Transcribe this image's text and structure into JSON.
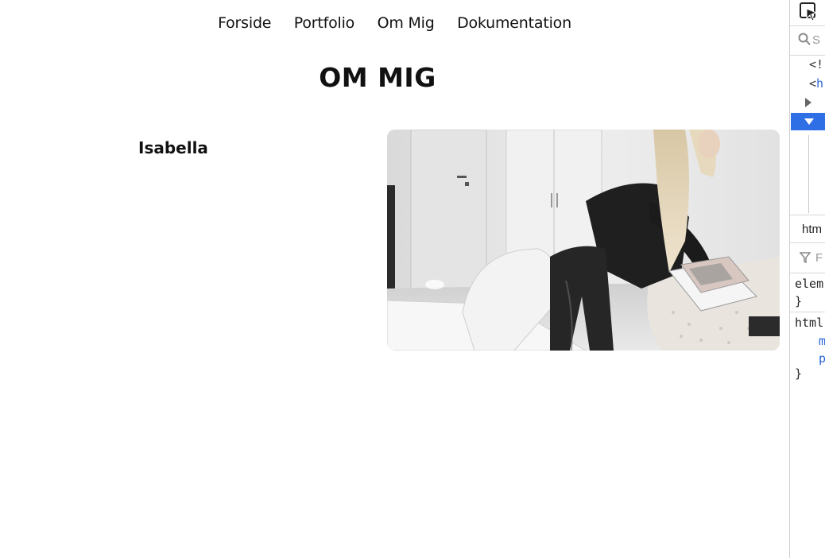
{
  "nav": {
    "items": [
      {
        "label": "Forside"
      },
      {
        "label": "Portfolio"
      },
      {
        "label": "Om Mig"
      },
      {
        "label": "Dokumentation"
      }
    ]
  },
  "page": {
    "title": "OM MIG",
    "name": "Isabella"
  },
  "devtools": {
    "search_text": "S",
    "tree": {
      "line1_text": "<!",
      "line2_bracket": "<",
      "line2_tag": "h",
      "line3_text": "·",
      "line4_text": "·"
    },
    "breadcrumb": "htm",
    "filter_text": "F",
    "rules": {
      "element_selector": "elem",
      "close1": "}",
      "html_selector": "html",
      "prop1": "m",
      "prop2": "p",
      "close2": "}"
    }
  },
  "colors": {
    "accent": "#2f6fe5",
    "tag": "#2a66d9",
    "text": "#111111"
  }
}
